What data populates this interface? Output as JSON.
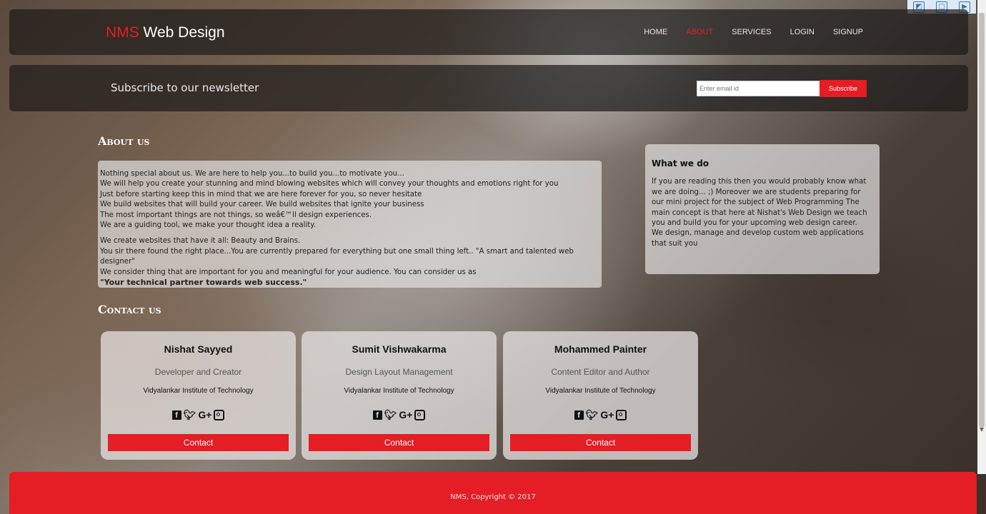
{
  "brand": {
    "accent": "NMS",
    "rest": "Web Design"
  },
  "nav": {
    "items": [
      "HOME",
      "ABOUT",
      "SERVICES",
      "LOGIN",
      "SIGNUP"
    ],
    "active": "ABOUT"
  },
  "newsletter": {
    "title": "Subscribe to our newsletter",
    "placeholder": "Enter email id",
    "button": "Subscribe"
  },
  "about": {
    "title": "About us",
    "lines1": [
      "Nothing special about us. We are here to help you...to build you...to motivate you...",
      "We will help you create your stunning and mind blowing websites which will convey your thoughts and emotions right for you",
      "Just before starting keep this in mind that we are here forever for you, so never hesitate",
      "We build websites that will build your career. We build websites that ignite your business",
      "The most important things are not things, so weâ€™ll design experiences.",
      "We are a guiding tool, we make your thought idea a reality."
    ],
    "lines2": [
      "We create websites that have it all: Beauty and Brains.",
      "You sir there found the right place...You are currently prepared for everything but one small thing left.. \"A smart and talented web designer\"",
      "We consider thing that are important for you and meaningful for your audience. You can consider us as"
    ],
    "tagline": "\"Your technical partner towards web success.\""
  },
  "what_we_do": {
    "title": "What we do",
    "text": "If you are reading this then you would probably know what we are doing... ;) Moreover we are students preparing for our mini project for the subject of Web Programming The main concept is that here at Nishat's Web Design we teach you and build you for your upcoming web design career.",
    "text2": "We design, manage and develop custom web applications that suit you"
  },
  "contact": {
    "title": "Contact us",
    "cards": [
      {
        "name": "Nishat Sayyed",
        "role": "Developer and Creator",
        "institute": "Vidyalankar Institute of Technology",
        "button": "Contact"
      },
      {
        "name": "Sumit Vishwakarma",
        "role": "Design Layout Management",
        "institute": "Vidyalankar Institute of Technology",
        "button": "Contact"
      },
      {
        "name": "Mohammed Painter",
        "role": "Content Editor and Author",
        "institute": "Vidyalankar Institute of Technology",
        "button": "Contact"
      }
    ],
    "social_icons": [
      "facebook-icon",
      "twitter-icon",
      "google-plus-icon",
      "instagram-icon"
    ]
  },
  "footer": {
    "text": "NMS, Copyright © 2017"
  },
  "colors": {
    "accent": "#e51d24",
    "panel": "rgba(30,28,26,0.72)"
  }
}
